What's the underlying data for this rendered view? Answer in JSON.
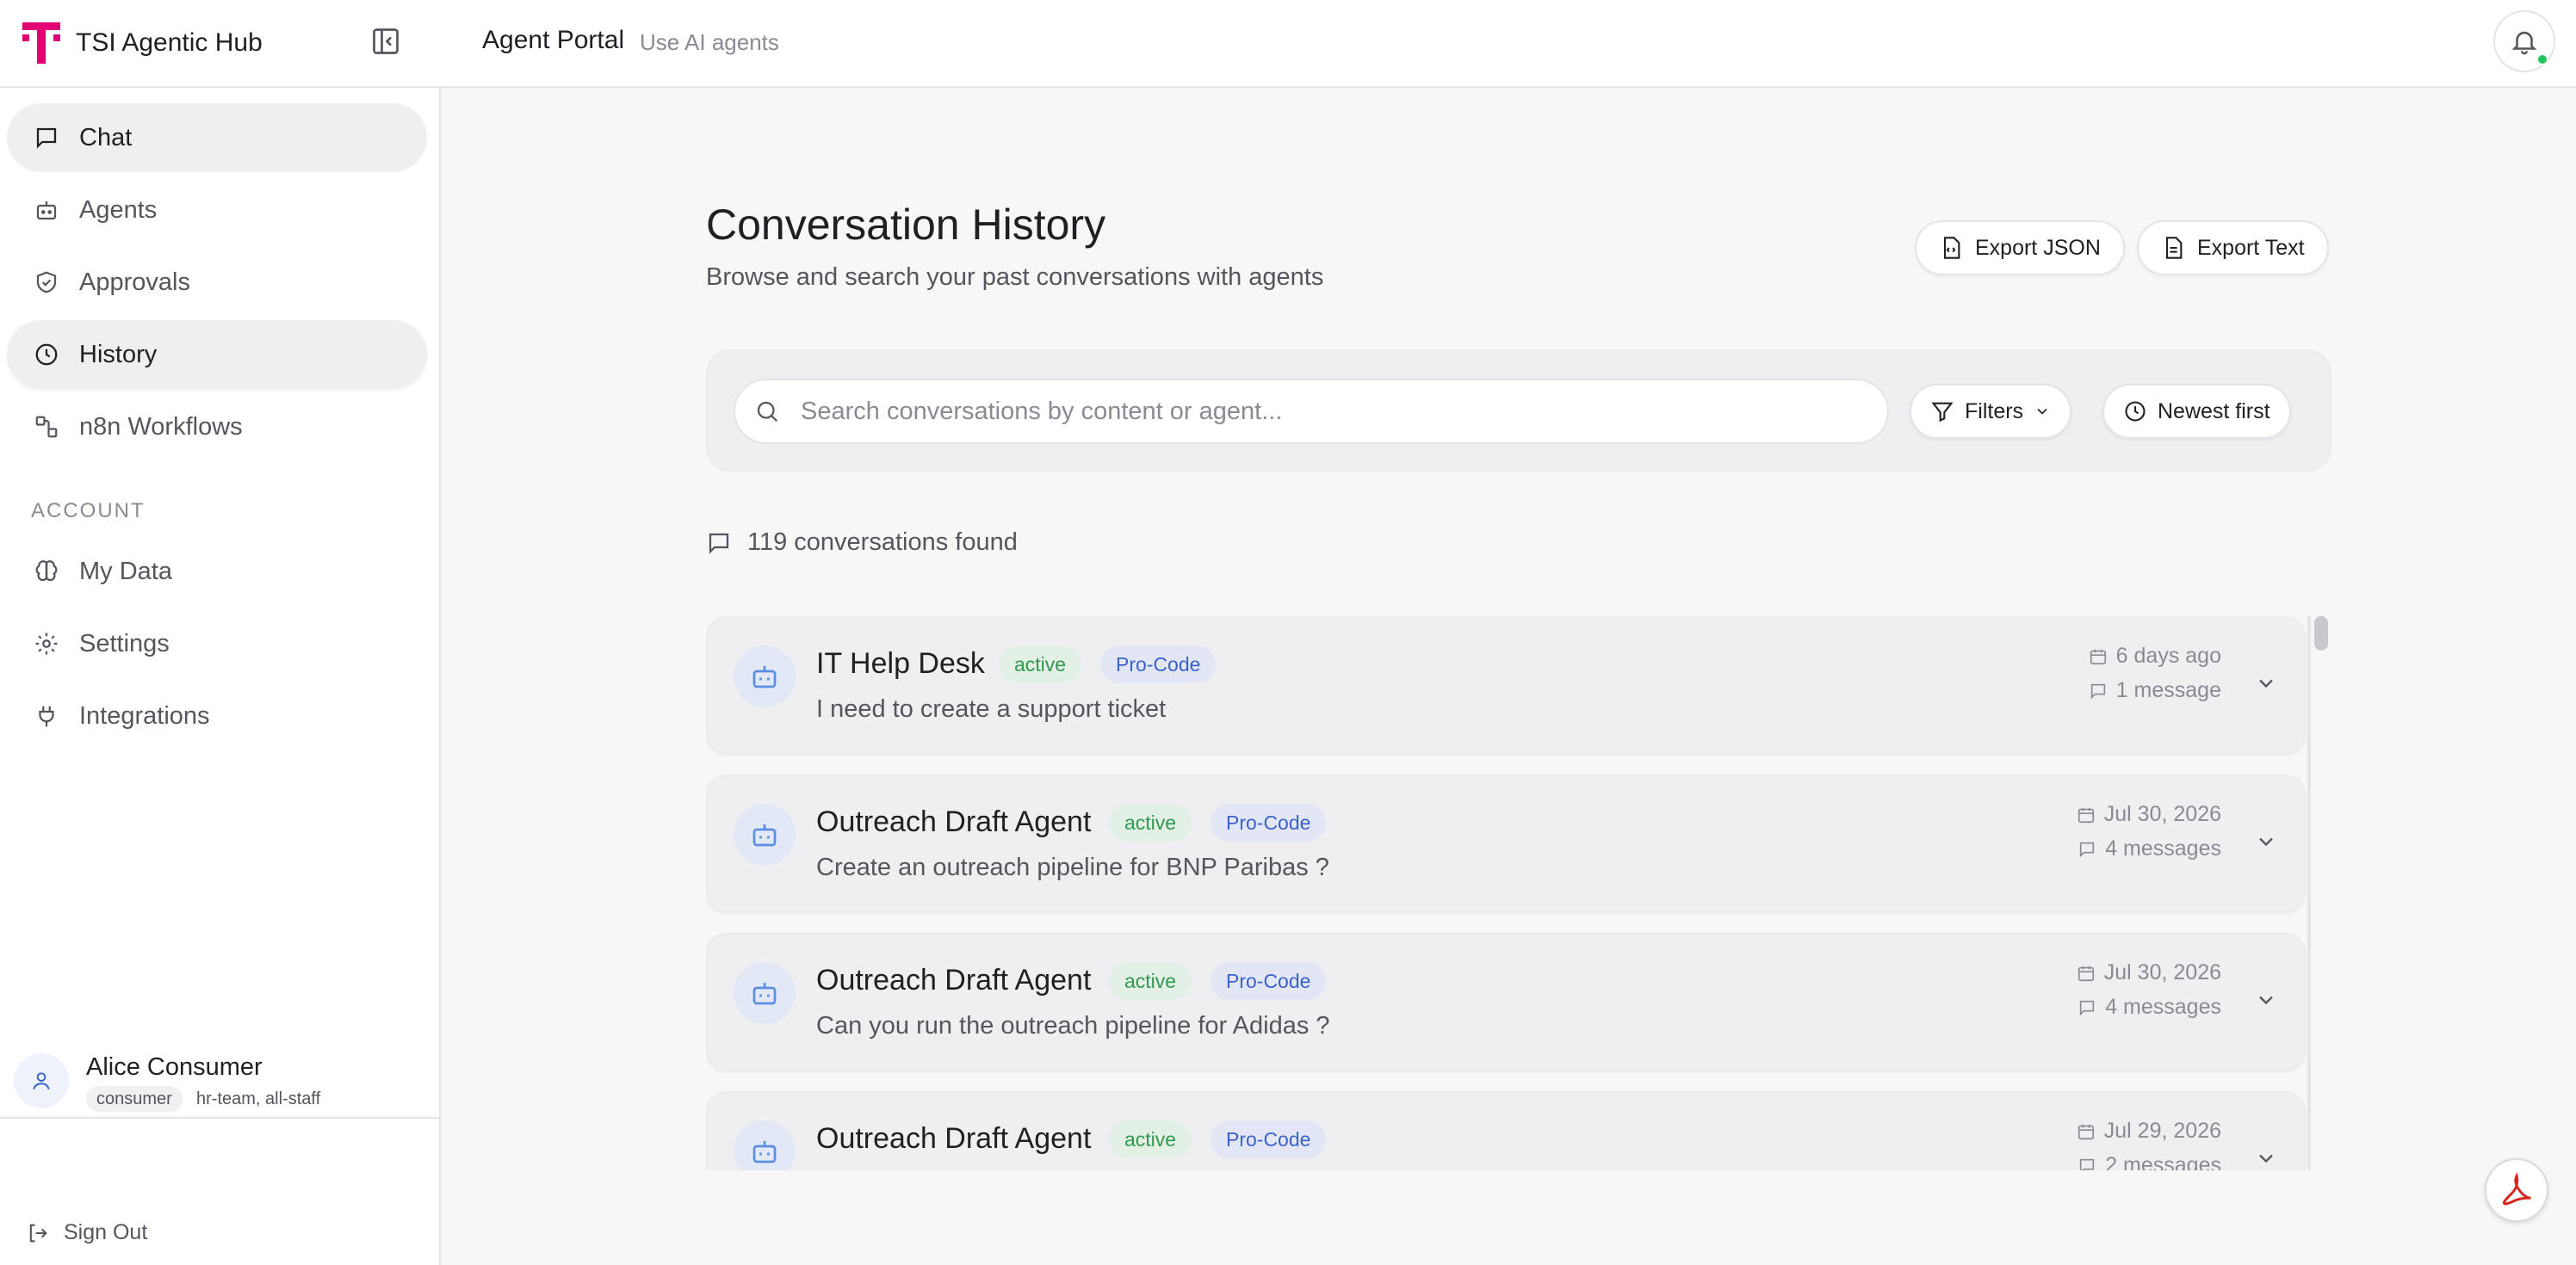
{
  "brand": {
    "name": "TSI Agentic Hub",
    "color": "#e20074"
  },
  "header": {
    "title": "Agent Portal",
    "subtitle": "Use AI agents"
  },
  "sidebar": {
    "items": [
      {
        "label": "Chat",
        "icon": "chat-bubble-icon"
      },
      {
        "label": "Agents",
        "icon": "robot-icon"
      },
      {
        "label": "Approvals",
        "icon": "shield-check-icon"
      },
      {
        "label": "History",
        "icon": "clock-icon"
      },
      {
        "label": "n8n Workflows",
        "icon": "workflow-icon"
      }
    ],
    "account_section": "ACCOUNT",
    "account_items": [
      {
        "label": "My Data",
        "icon": "brain-icon"
      },
      {
        "label": "Settings",
        "icon": "gear-icon"
      },
      {
        "label": "Integrations",
        "icon": "plug-icon"
      }
    ]
  },
  "user": {
    "name": "Alice Consumer",
    "role": "consumer",
    "groups": "hr-team, all-staff",
    "sign_out": "Sign Out"
  },
  "main": {
    "title": "Conversation History",
    "subtitle": "Browse and search your past conversations with agents",
    "export_json": "Export JSON",
    "export_text": "Export Text",
    "search": {
      "placeholder": "Search conversations by content or agent...",
      "value": ""
    },
    "filters_label": "Filters",
    "sort_label": "Newest first",
    "count_text": "119 conversations found",
    "conversations": [
      {
        "agent": "IT Help Desk",
        "status": "active",
        "type": "Pro-Code",
        "preview": "I need to create a support ticket",
        "date": "6 days ago",
        "messages": "1 message"
      },
      {
        "agent": "Outreach Draft Agent",
        "status": "active",
        "type": "Pro-Code",
        "preview": "Create an outreach pipeline for BNP Paribas ?",
        "date": "Jul 30, 2026",
        "messages": "4 messages"
      },
      {
        "agent": "Outreach Draft Agent",
        "status": "active",
        "type": "Pro-Code",
        "preview": "Can you run the outreach pipeline for Adidas ?",
        "date": "Jul 30, 2026",
        "messages": "4 messages"
      },
      {
        "agent": "Outreach Draft Agent",
        "status": "active",
        "type": "Pro-Code",
        "preview": "",
        "date": "Jul 29, 2026",
        "messages": "2 messages"
      }
    ]
  },
  "colors": {
    "active_green": "#2f9a4c",
    "pro_blue": "#3a62c9",
    "online_dot": "#22c55e"
  }
}
